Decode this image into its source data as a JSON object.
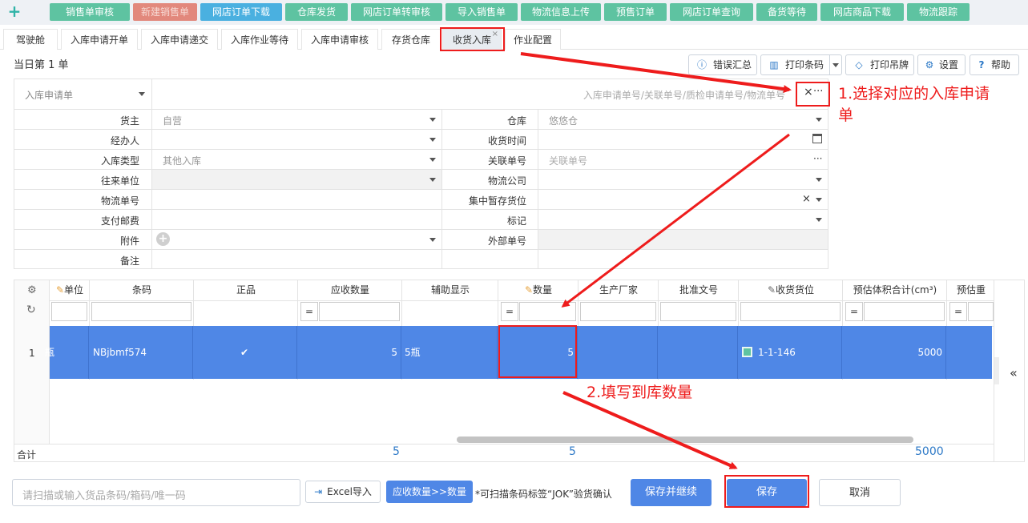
{
  "topnav": {
    "buttons": [
      "销售单审核",
      "新建销售单",
      "网店订单下载",
      "仓库发货",
      "网店订单转审核",
      "导入销售单",
      "物流信息上传",
      "预售订单",
      "网店订单查询",
      "备货等待",
      "网店商品下载",
      "物流跟踪"
    ]
  },
  "tabs": [
    "驾驶舱",
    "入库申请开单",
    "入库申请递交",
    "入库作业等待",
    "入库申请审核",
    "存货仓库",
    "收货入库",
    "作业配置"
  ],
  "active_tab_close": "×",
  "count_text": "当日第 1 单",
  "toolbar": {
    "error_summary": "错误汇总",
    "print_barcode": "打印条码",
    "print_tag": "打印吊牌",
    "settings": "设置",
    "help": "帮助"
  },
  "search": {
    "type_label": "入库申请单",
    "placeholder": "入库申请单号/关联单号/质检申请单号/物流单号",
    "clear": "×",
    "more": "···"
  },
  "annotations": {
    "step1_line1": "1.选择对应的入库申请",
    "step1_line2": "单",
    "step2": "2.填写到库数量"
  },
  "form": {
    "left": [
      {
        "label": "货主",
        "value": "自营"
      },
      {
        "label": "经办人",
        "value": ""
      },
      {
        "label": "入库类型",
        "value": "其他入库"
      },
      {
        "label": "往来单位",
        "value": ""
      },
      {
        "label": "物流单号",
        "value": ""
      },
      {
        "label": "支付邮费",
        "value": ""
      },
      {
        "label": "附件",
        "value": ""
      },
      {
        "label": "备注",
        "value": ""
      }
    ],
    "right": [
      {
        "label": "仓库",
        "value": "悠悠仓"
      },
      {
        "label": "收货时间",
        "value": ""
      },
      {
        "label": "关联单号",
        "value": "关联单号"
      },
      {
        "label": "物流公司",
        "value": ""
      },
      {
        "label": "集中暂存货位",
        "value": ""
      },
      {
        "label": "标记",
        "value": ""
      },
      {
        "label": "外部单号",
        "value": ""
      }
    ]
  },
  "grid": {
    "columns": [
      "单位",
      "条码",
      "正品",
      "应收数量",
      "辅助显示",
      "数量",
      "生产厂家",
      "批准文号",
      "收货货位",
      "预估体积合计(cm³)",
      "预估重"
    ],
    "filter_eq": "=",
    "row": {
      "index": "1",
      "unit": "瓶",
      "barcode": "NBjbmf574",
      "genuine": "✔",
      "expected_qty": "5",
      "aux_display": "5瓶",
      "qty": "5",
      "manufacturer": "",
      "approval_no": "",
      "location": "1-1-146",
      "est_volume": "5000"
    },
    "sum_label": "合计",
    "sums": {
      "expected_qty": "5",
      "qty": "5",
      "est_volume": "5000"
    },
    "collapse": "«"
  },
  "footer": {
    "scan_placeholder": "请扫描或输入货品条码/箱码/唯一码",
    "excel_import": "Excel导入",
    "fill_qty": "应收数量>>数量",
    "hint": "*可扫描条码标签“JOK”验货确认",
    "save_continue": "保存并继续",
    "save": "保存",
    "cancel": "取消"
  },
  "colors": {
    "accent": "#4f87e6",
    "annotation": "#ee1c1c",
    "nav_green": "#5ec3a1"
  }
}
